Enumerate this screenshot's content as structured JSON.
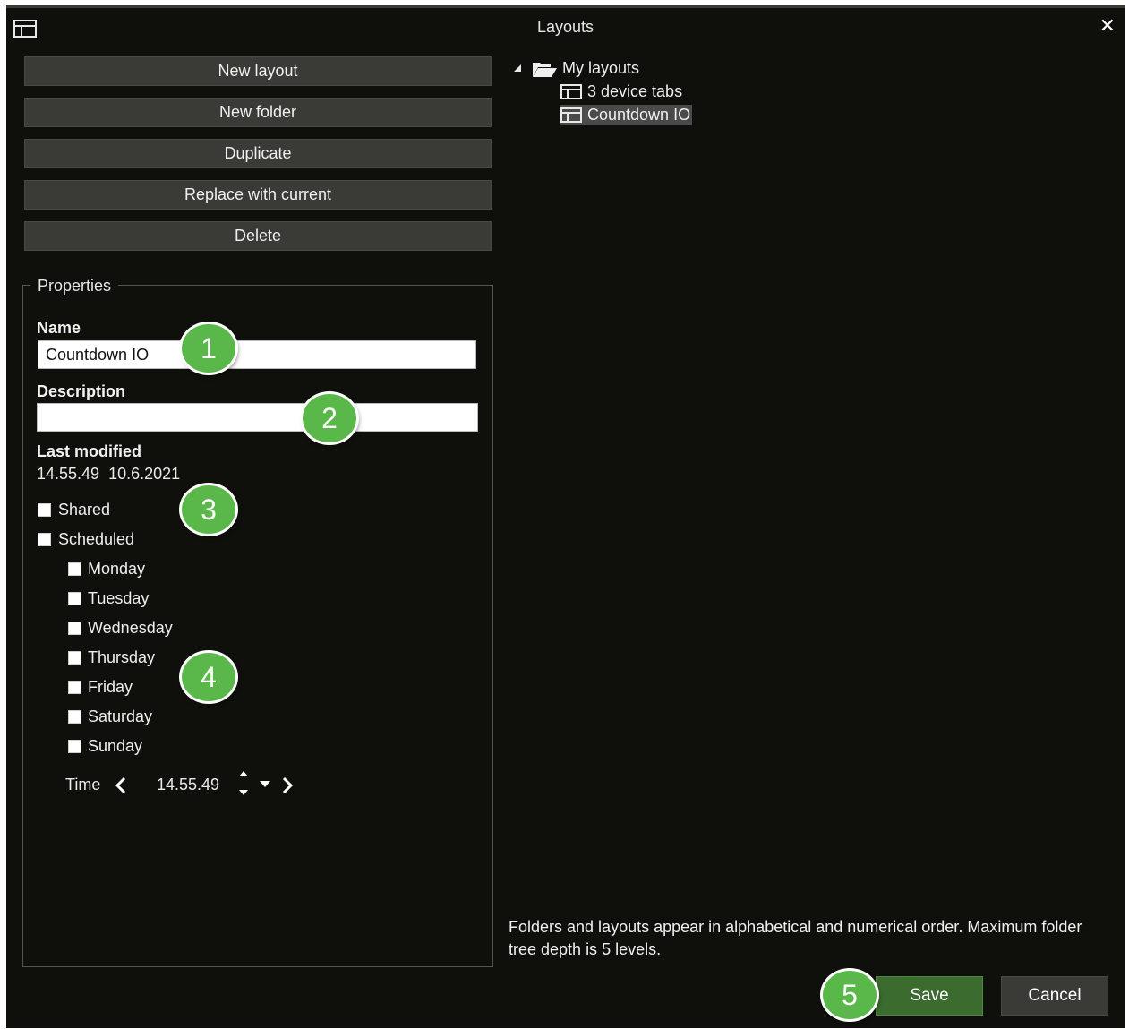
{
  "window": {
    "title": "Layouts",
    "close_glyph": "✕"
  },
  "actions": {
    "new_layout": "New layout",
    "new_folder": "New folder",
    "duplicate": "Duplicate",
    "replace_with_current": "Replace with current",
    "delete": "Delete"
  },
  "properties": {
    "legend": "Properties",
    "name_label": "Name",
    "name_value": "Countdown IO",
    "description_label": "Description",
    "description_value": "",
    "last_modified_label": "Last modified",
    "last_modified_value": "14.55.49  10.6.2021",
    "shared_label": "Shared",
    "scheduled_label": "Scheduled",
    "days": [
      "Monday",
      "Tuesday",
      "Wednesday",
      "Thursday",
      "Friday",
      "Saturday",
      "Sunday"
    ],
    "time_label": "Time",
    "time_value": "14.55.49"
  },
  "tree": {
    "folder": "My layouts",
    "items": [
      "3 device tabs",
      "Countdown IO"
    ],
    "selected": "Countdown IO"
  },
  "note": "Folders and layouts appear in alphabetical and numerical order. Maximum folder tree depth is 5 levels.",
  "footer": {
    "save": "Save",
    "cancel": "Cancel"
  },
  "badges": [
    "1",
    "2",
    "3",
    "4",
    "5"
  ],
  "colors": {
    "background": "#0f0f0b",
    "button": "#3a3a36",
    "save": "#3b6b2e",
    "badge": "#5ab84a",
    "selection": "#4a4a4a"
  }
}
